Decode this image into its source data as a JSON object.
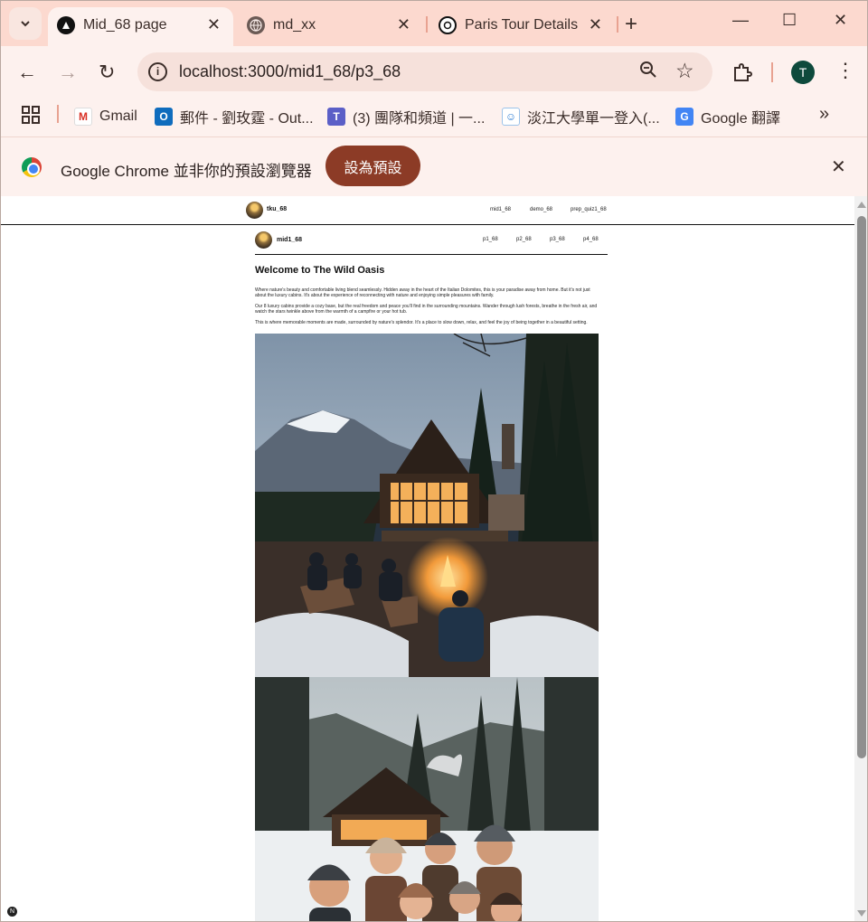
{
  "browser": {
    "tabs": [
      {
        "title": "Mid_68 page",
        "icon": "triangle-logo-icon",
        "active": true
      },
      {
        "title": "md_xx",
        "icon": "globe-icon",
        "active": false
      },
      {
        "title": "Paris Tour Details",
        "icon": "openai-icon",
        "active": false
      }
    ],
    "url": "localhost:3000/mid1_68/p3_68",
    "profile_initial": "T",
    "bookmarks": [
      {
        "label": "Gmail",
        "icon": "gmail-icon"
      },
      {
        "label": "郵件 - 劉玫霆 - Out...",
        "icon": "outlook-icon"
      },
      {
        "label": "(3) 團隊和頻道 | 一...",
        "icon": "teams-icon"
      },
      {
        "label": "淡江大學單一登入(...",
        "icon": "tku-sso-icon"
      },
      {
        "label": "Google 翻譯",
        "icon": "google-translate-icon"
      }
    ],
    "infobar": {
      "message": "Google Chrome 並非你的預設瀏覽器",
      "button": "設為預設"
    }
  },
  "page": {
    "outer_nav": {
      "brand": "tku_68",
      "links": [
        "mid1_68",
        "demo_68",
        "prep_quiz1_68"
      ]
    },
    "inner_nav": {
      "brand": "mid1_68",
      "links": [
        "p1_68",
        "p2_68",
        "p3_68",
        "p4_68"
      ]
    },
    "heading": "Welcome to The Wild Oasis",
    "paragraphs": [
      "Where nature's beauty and comfortable living blend seamlessly. Hidden away in the heart of the Italian Dolomites, this is your paradise away from home. But it's not just about the luxury cabins. It's about the experience of reconnecting with nature and enjoying simple pleasures with family.",
      "Our 8 luxury cabins provide a cozy base, but the real freedom and peace you'll find in the surrounding mountains. Wander through lush forests, breathe in the fresh air, and watch the stars twinkle above from the warmth of a campfire or your hot tub.",
      "This is where memorable moments are made, surrounded by nature's splendor. It's a place to slow down, relax, and feel the joy of being together in a beautiful setting."
    ],
    "images": [
      "cabin-campfire-photo",
      "family-in-snow-photo"
    ],
    "dev_badge": "N"
  }
}
